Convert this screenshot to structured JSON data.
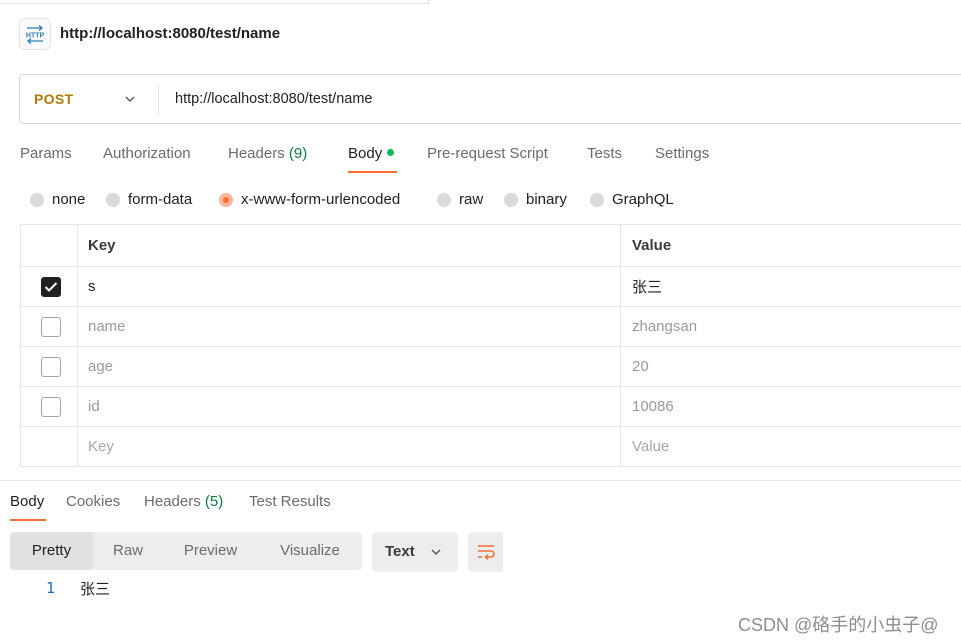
{
  "request": {
    "icon_label": "HTTP",
    "title": "http://localhost:8080/test/name",
    "method": "POST",
    "url": "http://localhost:8080/test/name"
  },
  "request_tabs": [
    {
      "label": "Params",
      "count": ""
    },
    {
      "label": "Authorization",
      "count": ""
    },
    {
      "label": "Headers",
      "count": "(9)"
    },
    {
      "label": "Body",
      "count": ""
    },
    {
      "label": "Pre-request Script",
      "count": ""
    },
    {
      "label": "Tests",
      "count": ""
    },
    {
      "label": "Settings",
      "count": ""
    }
  ],
  "active_request_tab": "Body",
  "body_types": [
    "none",
    "form-data",
    "x-www-form-urlencoded",
    "raw",
    "binary",
    "GraphQL"
  ],
  "selected_body_type": "x-www-form-urlencoded",
  "table": {
    "headers": {
      "key": "Key",
      "value": "Value"
    },
    "rows": [
      {
        "checked": true,
        "key": "s",
        "value": "张三"
      },
      {
        "checked": false,
        "key": "name",
        "value": "zhangsan"
      },
      {
        "checked": false,
        "key": "age",
        "value": "20"
      },
      {
        "checked": false,
        "key": "id",
        "value": "10086"
      }
    ],
    "placeholder": {
      "key": "Key",
      "value": "Value"
    }
  },
  "response_tabs": [
    {
      "label": "Body",
      "count": ""
    },
    {
      "label": "Cookies",
      "count": ""
    },
    {
      "label": "Headers",
      "count": "(5)"
    },
    {
      "label": "Test Results",
      "count": ""
    }
  ],
  "active_response_tab": "Body",
  "view_modes": [
    "Pretty",
    "Raw",
    "Preview",
    "Visualize"
  ],
  "active_view_mode": "Pretty",
  "format_label": "Text",
  "response_body": [
    {
      "line": "1",
      "text": "张三"
    }
  ],
  "watermark": "CSDN @硌手的小虫子@",
  "colors": {
    "accent": "#ff6c37",
    "method_post": "#ad7a03",
    "count_green": "#0f7b3d",
    "dot_green": "#0cbb52"
  }
}
